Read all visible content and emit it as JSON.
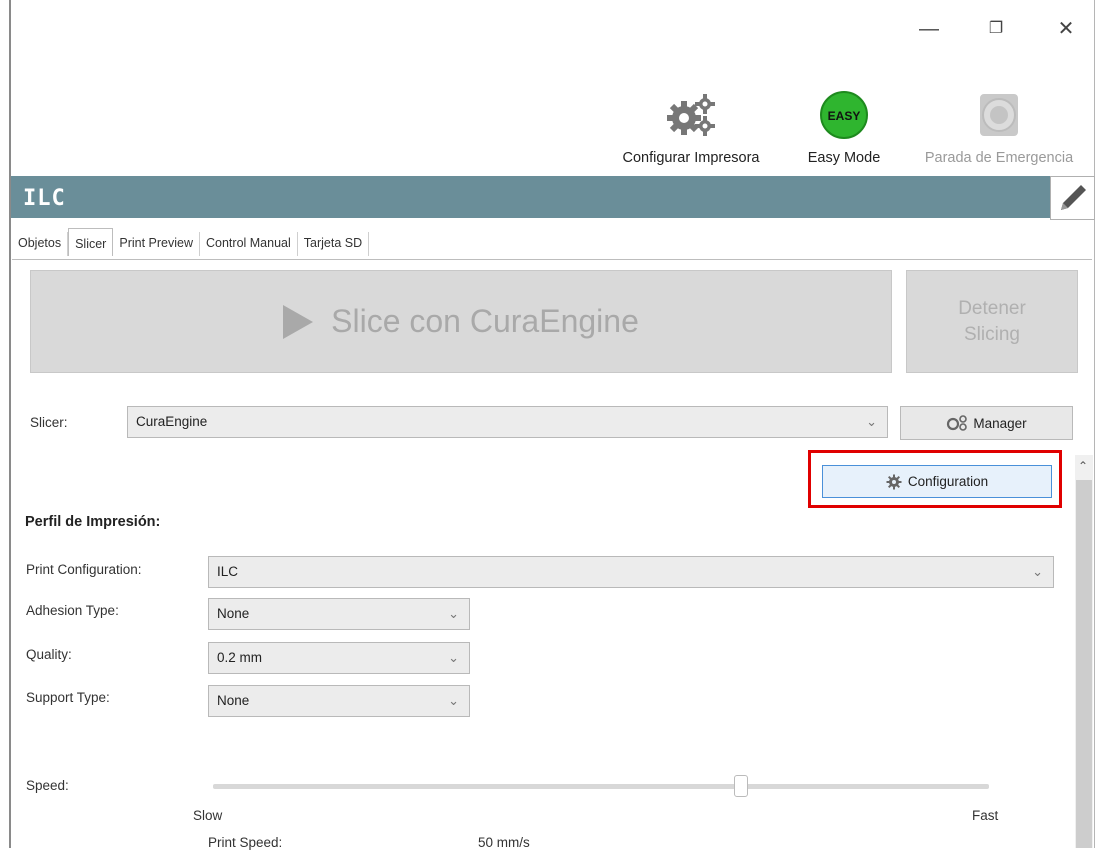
{
  "window": {
    "minimize_glyph": "—",
    "restore_glyph": "❐",
    "close_glyph": "✕"
  },
  "toolbar": {
    "configure_printer_label": "Configurar Impresora",
    "easy_mode_label": "Easy Mode",
    "easy_badge_text": "EASY",
    "emergency_stop_label": "Parada de Emergencia"
  },
  "printer": {
    "name": "ILC"
  },
  "tabs": [
    {
      "label": "Objetos"
    },
    {
      "label": "Slicer"
    },
    {
      "label": "Print Preview"
    },
    {
      "label": "Control Manual"
    },
    {
      "label": "Tarjeta SD"
    }
  ],
  "slicer_panel": {
    "slice_button_label": "Slice con CuraEngine",
    "stop_button_line1": "Detener",
    "stop_button_line2": "Slicing",
    "slicer_label": "Slicer:",
    "slicer_value": "CuraEngine",
    "manager_label": "Manager",
    "configuration_label": "Configuration"
  },
  "profile": {
    "section_title": "Perfil de Impresión:",
    "print_configuration_label": "Print Configuration:",
    "print_configuration_value": "ILC",
    "adhesion_label": "Adhesion Type:",
    "adhesion_value": "None",
    "quality_label": "Quality:",
    "quality_value": "0.2 mm",
    "support_label": "Support Type:",
    "support_value": "None",
    "speed_label": "Speed:",
    "speed_level": 0.68,
    "slow_label": "Slow",
    "fast_label": "Fast",
    "print_speed_label": "Print Speed:",
    "print_speed_value": "50 mm/s"
  },
  "colors": {
    "banner": "#6a8e99",
    "highlight_border": "#e00000",
    "easy_green": "#2fb52f"
  }
}
